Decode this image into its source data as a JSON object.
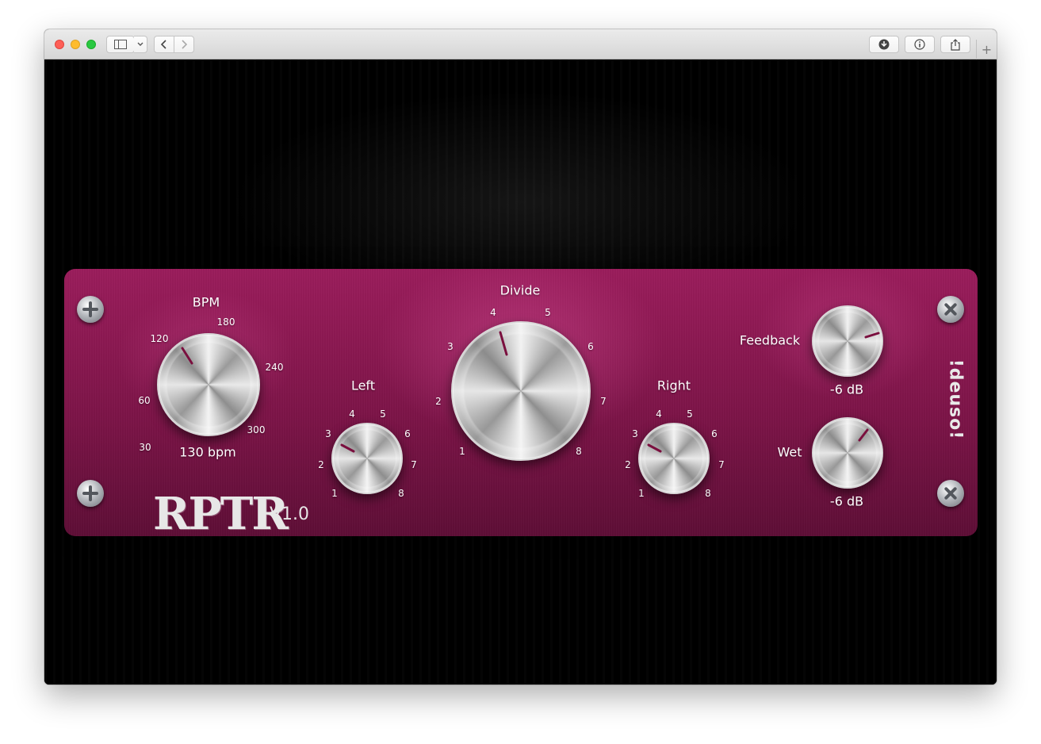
{
  "toolbar": {
    "traffic_lights": [
      "close",
      "minimize",
      "zoom"
    ],
    "sidebar_icon": "sidebar-icon",
    "dropdown_icon": "chevron-down-icon",
    "back_icon": "chevron-left-icon",
    "forward_icon": "chevron-right-icon",
    "download_icon": "download-icon",
    "info_icon": "info-icon",
    "share_icon": "share-icon",
    "new_tab_label": "+"
  },
  "plugin": {
    "logo": "RPTR",
    "version": "V1.0",
    "brand": "!deuso!",
    "bpm": {
      "label": "BPM",
      "value_text": "130 bpm",
      "ticks": [
        "30",
        "60",
        "120",
        "180",
        "240",
        "300"
      ],
      "value": 130
    },
    "left": {
      "label": "Left",
      "ticks": [
        "1",
        "2",
        "3",
        "4",
        "5",
        "6",
        "7",
        "8"
      ],
      "value": 3
    },
    "divide": {
      "label": "Divide",
      "ticks": [
        "1",
        "2",
        "3",
        "4",
        "5",
        "6",
        "7",
        "8"
      ],
      "value": 4
    },
    "right": {
      "label": "Right",
      "ticks": [
        "1",
        "2",
        "3",
        "4",
        "5",
        "6",
        "7",
        "8"
      ],
      "value": 3
    },
    "feedback": {
      "label": "Feedback",
      "value_text": "-6 dB"
    },
    "wet": {
      "label": "Wet",
      "value_text": "-6 dB"
    }
  },
  "colors": {
    "panel": "#8a1650",
    "pointer": "#7a0f3e",
    "background": "#000000"
  }
}
